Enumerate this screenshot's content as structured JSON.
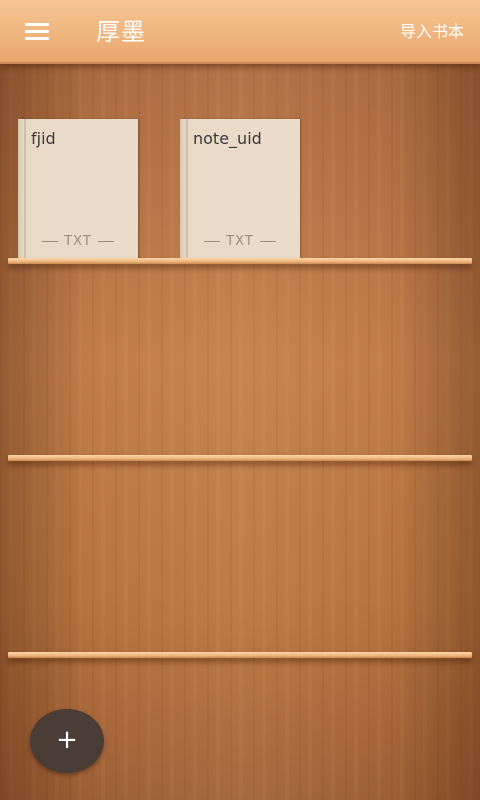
{
  "header": {
    "title": "厚墨",
    "menu_icon": "hamburger-menu-icon",
    "import_label": "导入书本"
  },
  "shelf": {
    "books": [
      {
        "title": "fjid",
        "format": "TXT"
      },
      {
        "title": "note_uid",
        "format": "TXT"
      }
    ]
  },
  "fab": {
    "icon": "plus-icon",
    "label": "+"
  },
  "colors": {
    "topbar": "#efb37c",
    "wood": "#b6743f",
    "book_cover": "#eadccb",
    "fab": "#4a3d35"
  }
}
